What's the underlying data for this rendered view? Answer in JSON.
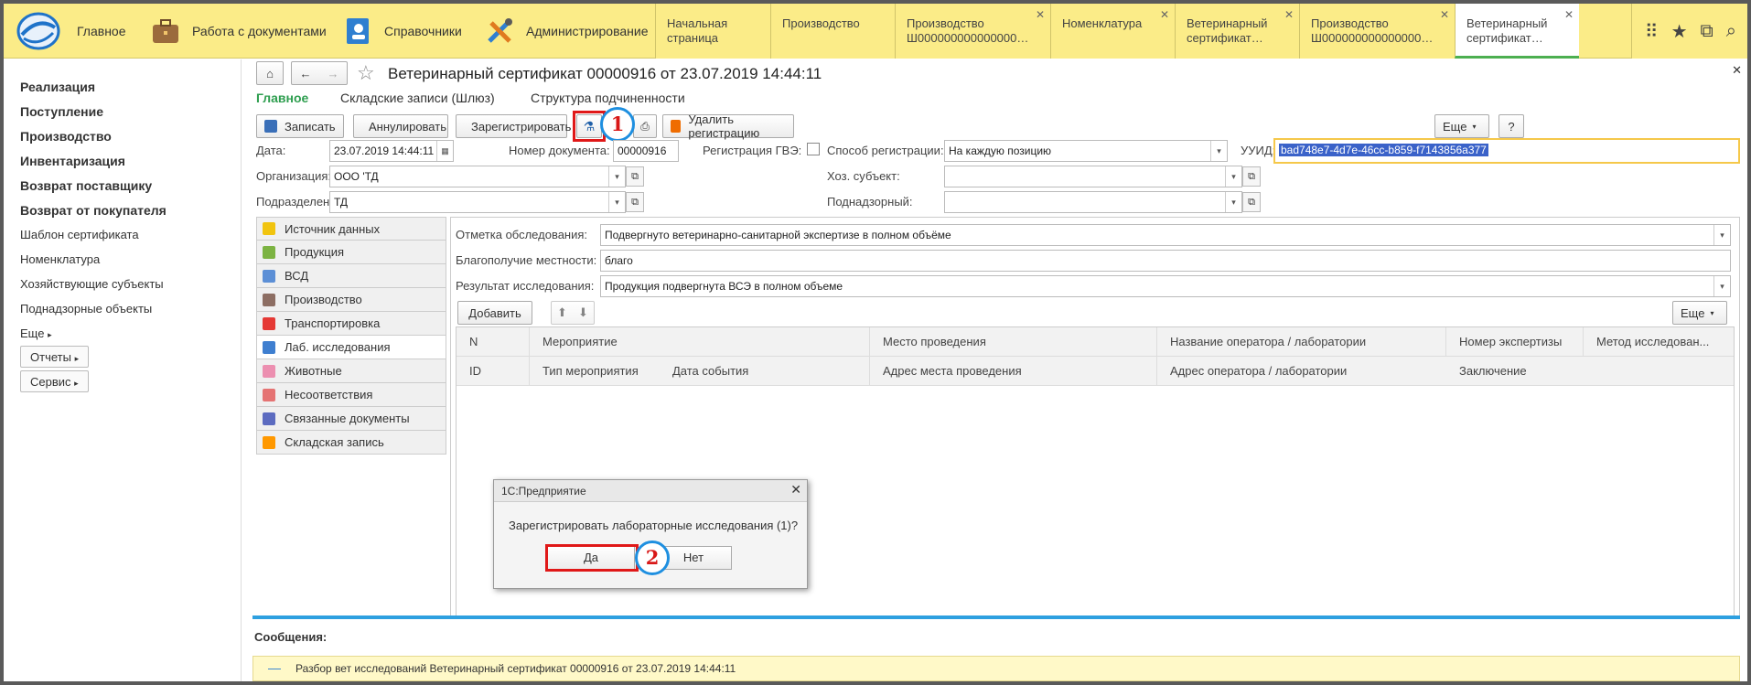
{
  "topbar": {
    "home_label": "Главное",
    "sections": [
      {
        "label": "Работа с документами",
        "icon": "briefcase-icon"
      },
      {
        "label": "Справочники",
        "icon": "address-book-icon"
      },
      {
        "label": "Администрирование",
        "icon": "tools-icon"
      }
    ],
    "tabs": [
      {
        "line1": "Начальная страница",
        "line2": "",
        "closable": false
      },
      {
        "line1": "Производство",
        "line2": "",
        "closable": false
      },
      {
        "line1": "Производство",
        "line2": "Ш000000000000000…",
        "closable": true
      },
      {
        "line1": "Номенклатура",
        "line2": "",
        "closable": true
      },
      {
        "line1": "Ветеринарный",
        "line2": "сертификат…",
        "closable": true
      },
      {
        "line1": "Производство",
        "line2": "Ш000000000000000…",
        "closable": true
      },
      {
        "line1": "Ветеринарный",
        "line2": "сертификат…",
        "closable": true,
        "active": true
      }
    ],
    "icons": [
      "grid-icon",
      "star-icon",
      "history-icon",
      "search-icon"
    ]
  },
  "sidebar": {
    "items": [
      {
        "label": "Реализация",
        "bold": true
      },
      {
        "label": "Поступление",
        "bold": true
      },
      {
        "label": "Производство",
        "bold": true
      },
      {
        "label": "Инвентаризация",
        "bold": true
      },
      {
        "label": "Возврат поставщику",
        "bold": true
      },
      {
        "label": "Возврат от покупателя",
        "bold": true
      },
      {
        "label": "Шаблон сертификата",
        "bold": false
      },
      {
        "label": "Номенклатура",
        "bold": false
      },
      {
        "label": "Хозяйствующие субъекты",
        "bold": false
      },
      {
        "label": "Поднадзорные объекты",
        "bold": false
      },
      {
        "label": "Еще",
        "bold": false
      }
    ],
    "buttons": [
      "Отчеты",
      "Сервис"
    ]
  },
  "document": {
    "title": "Ветеринарный сертификат 00000916 от 23.07.2019 14:44:11",
    "subtabs": [
      "Главное",
      "Складские записи (Шлюз)",
      "Структура подчиненности"
    ]
  },
  "toolbar": {
    "save": "Записать",
    "cancel": "Аннулировать",
    "register": "Зарегистрировать",
    "delete_reg": "Удалить регистрацию",
    "more": "Еще",
    "help": "?"
  },
  "form": {
    "date_label": "Дата:",
    "date_value": "23.07.2019 14:44:11",
    "docnum_label": "Номер документа:",
    "docnum_value": "00000916",
    "gve_label": "Регистрация ГВЭ:",
    "method_label": "Способ регистрации:",
    "method_value": "На каждую позицию",
    "uuid_label": "УУИД:",
    "uuid_value": "bad748e7-4d7e-46cc-b859-f7143856a377",
    "org_label": "Организация:",
    "org_value": "ООО 'ТД",
    "subject_label": "Хоз. субъект:",
    "subject_value": "",
    "dept_label": "Подразделение:",
    "dept_value": "ТД",
    "supervised_label": "Поднадзорный:",
    "supervised_value": ""
  },
  "nav": [
    {
      "label": "Источник данных",
      "color": "#f1c40f"
    },
    {
      "label": "Продукция",
      "color": "#7cb342"
    },
    {
      "label": "ВСД",
      "color": "#5c8fd6"
    },
    {
      "label": "Производство",
      "color": "#8d6e63"
    },
    {
      "label": "Транспортировка",
      "color": "#e53935"
    },
    {
      "label": "Лаб. исследования",
      "color": "#3f7fd0",
      "active": true
    },
    {
      "label": "Животные",
      "color": "#ec8fb0"
    },
    {
      "label": "Несоответствия",
      "color": "#e57373"
    },
    {
      "label": "Связанные документы",
      "color": "#5c6bc0"
    },
    {
      "label": "Складская запись",
      "color": "#ff9800"
    }
  ],
  "lab": {
    "mark_label": "Отметка обследования:",
    "mark_value": "Подвергнуто ветеринарно-санитарной экспертизе в полном объёме",
    "wellbeing_label": "Благополучие местности:",
    "wellbeing_value": "благо",
    "result_label": "Результат исследования:",
    "result_value": "Продукция подвергнута ВСЭ в полном объеме",
    "add": "Добавить",
    "more": "Еще"
  },
  "table": {
    "row1": [
      "N",
      "Мероприятие",
      "Место проведения",
      "Название оператора / лаборатории",
      "Номер экспертизы",
      "Метод исследован..."
    ],
    "row2": [
      "ID",
      "Тип мероприятия",
      "Дата события",
      "Адрес места проведения",
      "Адрес оператора / лаборатории",
      "Заключение"
    ]
  },
  "dialog": {
    "title": "1С:Предприятие",
    "message": "Зарегистрировать лабораторные исследования (1)?",
    "yes": "Да",
    "no": "Нет"
  },
  "messages": {
    "header": "Сообщения:",
    "item": "Разбор вет исследований Ветеринарный сертификат 00000916 от 23.07.2019 14:44:11"
  },
  "annotations": {
    "marker1": "1",
    "marker2": "2"
  },
  "colors": {
    "accent_green": "#2e9e4f",
    "topbar_yellow": "#fbec88",
    "message_bar": "#fff9c8",
    "separator_blue": "#2ea0e0",
    "highlight_red": "#e01818",
    "marker_blue": "#1e8fe0"
  }
}
